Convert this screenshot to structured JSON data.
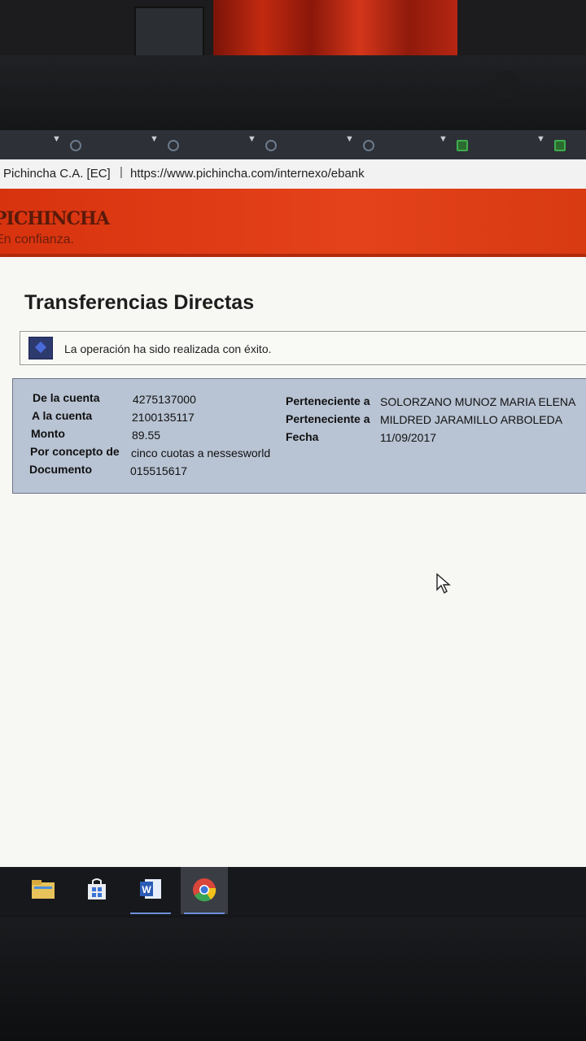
{
  "browser": {
    "site_name": "Pichincha C.A. [EC]",
    "separator": "|",
    "url": "https://www.pichincha.com/internexo/ebank"
  },
  "brand": {
    "name": "PICHINCHA",
    "tagline": "En confianza."
  },
  "page": {
    "title": "Transferencias Directas",
    "success_message": "La operación ha sido realizada con éxito."
  },
  "details": {
    "from_label": "De la cuenta",
    "from_value": "4275137000",
    "to_label": "A la cuenta",
    "to_value": "2100135117",
    "amount_label": "Monto",
    "amount_value": "89.55",
    "concept_label": "Por concepto de",
    "concept_value": "cinco cuotas a nessesworld",
    "document_label": "Documento",
    "document_value": "015515617",
    "owner_from_label": "Perteneciente a",
    "owner_from_value": "SOLORZANO MUNOZ MARIA ELENA",
    "owner_to_label": "Perteneciente a",
    "owner_to_value": "MILDRED JARAMILLO ARBOLEDA",
    "date_label": "Fecha",
    "date_value": "11/09/2017"
  },
  "taskbar": {
    "items": [
      "file-explorer-icon",
      "store-icon",
      "word-icon",
      "chrome-icon"
    ]
  },
  "colors": {
    "brand_red": "#d8330f",
    "panel_bg": "#b8c3d3",
    "taskbar": "#16181c"
  }
}
